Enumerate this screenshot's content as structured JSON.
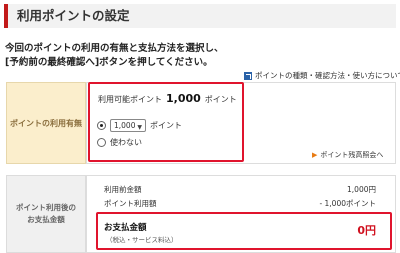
{
  "page_title": "利用ポイントの設定",
  "instruction": {
    "line1": "今回のポイントの利用の有無と支払方法を選択し、",
    "line2": "[予約前の最終確認へ]ボタンを押してください。"
  },
  "help_link": "ポイントの種類・確認方法・使い方について",
  "points_section": {
    "label": "ポイントの利用有無",
    "available_label": "利用可能ポイント",
    "available_value": "1,000",
    "available_unit": "ポイント",
    "use_option": {
      "selected_value": "1,000",
      "unit": "ポイント",
      "checked": true
    },
    "no_use_label": "使わない",
    "history_link": "ポイント残高照会へ"
  },
  "payment_section": {
    "label_line1": "ポイント利用後の",
    "label_line2": "お支払金額",
    "rows": [
      {
        "label": "利用前金額",
        "value": "1,000円"
      },
      {
        "label": "ポイント利用額",
        "value": "- 1,000ポイント"
      }
    ],
    "total_label": "お支払金額",
    "total_note": "（税込・サービス料込）",
    "total_value": "0円"
  },
  "colors": {
    "accent_red": "#e0142d",
    "title_bar": "#c21a1a",
    "section1_bg": "#fbeecc",
    "link_blue": "#2a62a8",
    "arrow_orange": "#e87a12"
  },
  "icons": {
    "help": "external-link-icon",
    "history": "triangle-arrow-icon",
    "select": "chevron-down-icon"
  }
}
